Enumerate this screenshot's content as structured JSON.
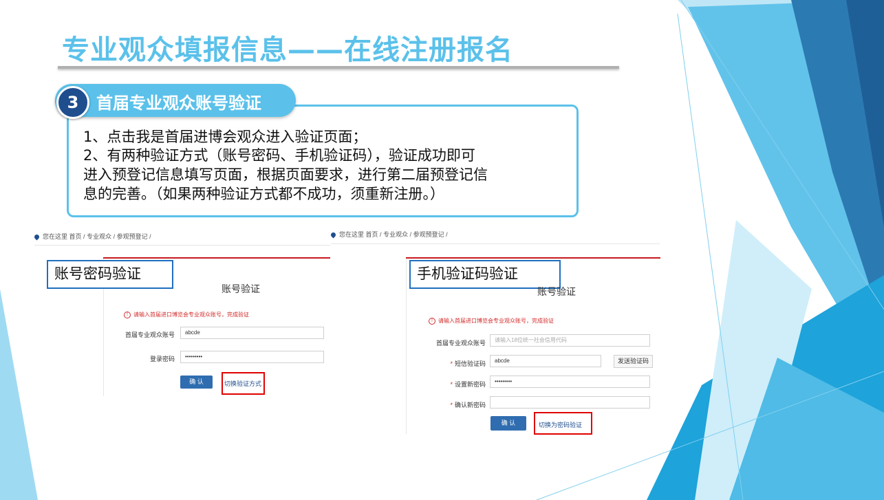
{
  "slide": {
    "title": "专业观众填报信息——在线注册报名",
    "step": {
      "number": "3",
      "title": "首届专业观众账号验证",
      "lines": [
        "1、点击我是首届进博会观众进入验证页面；",
        "2、有两种验证方式（账号密码、手机验证码），验证成功即可",
        "进入预登记信息填写页面，根据页面要求，进行第二届预登记信",
        "息的完善。（如果两种验证方式都不成功，须重新注册。）"
      ]
    },
    "colors": {
      "title": "#5bc1ea",
      "badge": "#1f4e8e",
      "highlight_box": "#e00000",
      "label_border": "#1f6fc0",
      "button": "#2f6db0"
    }
  },
  "left_panel": {
    "breadcrumb": {
      "icon": "location-pin-icon",
      "prefix": "您在这里",
      "items": [
        "首页",
        "专业观众",
        "参观预登记"
      ]
    },
    "label": "账号密码验证",
    "form_title": "账号验证",
    "warning": "请输入首届进口博览会专业观众账号，完成验证",
    "fields": [
      {
        "label": "首届专业观众账号",
        "value": "abcde"
      },
      {
        "label": "登录密码",
        "value": "•••••••••"
      }
    ],
    "confirm_label": "确 认",
    "switch_link": "切换验证方式"
  },
  "right_panel": {
    "breadcrumb": {
      "icon": "location-pin-icon",
      "prefix": "您在这里",
      "items": [
        "首页",
        "专业观众",
        "参观预登记"
      ]
    },
    "label": "手机验证码验证",
    "form_title": "账号验证",
    "warning": "请输入首届进口博览会专业观众账号，完成验证",
    "fields": [
      {
        "label": "首届专业观众账号",
        "required": false,
        "placeholder": "请输入18位统一社会信用代码",
        "value": ""
      },
      {
        "label": "短信验证码",
        "required": true,
        "value": "abcde"
      },
      {
        "label": "设置新密码",
        "required": true,
        "value": "•••••••••"
      },
      {
        "label": "确认新密码",
        "required": true,
        "value": ""
      }
    ],
    "send_code_label": "发送验证码",
    "confirm_label": "确 认",
    "switch_link": "切换为密码验证"
  }
}
